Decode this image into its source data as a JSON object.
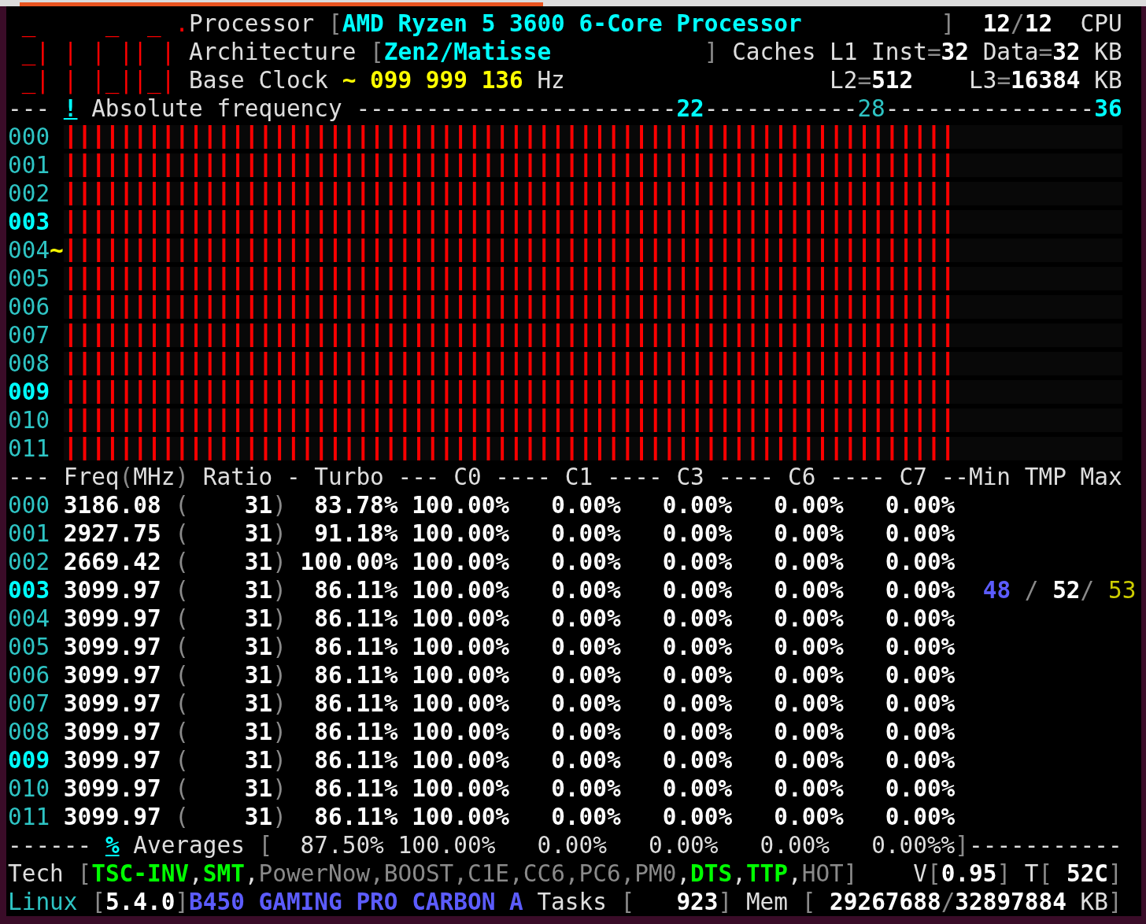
{
  "header": [
    [
      {
        "kind": "red",
        "text": " _     _  _ ."
      },
      {
        "kind": "text",
        "text": "Processor "
      },
      {
        "kind": "dim",
        "text": "["
      },
      {
        "kind": "cyan",
        "text": "AMD Ryzen 5 3600 6-Core Processor"
      },
      {
        "kind": "dim",
        "text": "          ]"
      },
      {
        "kind": "bold",
        "text": "  12"
      },
      {
        "kind": "dim",
        "text": "/"
      },
      {
        "kind": "bold",
        "text": "12"
      },
      {
        "kind": "text",
        "text": "  CPU"
      }
    ],
    [
      {
        "kind": "red",
        "text": " _| | | || |"
      },
      {
        "kind": "text",
        "text": " Architecture "
      },
      {
        "kind": "dim",
        "text": "["
      },
      {
        "kind": "cyan",
        "text": "Zen2/Matisse"
      },
      {
        "kind": "dim",
        "text": "           ]"
      },
      {
        "kind": "text",
        "text": " Caches L1 Inst"
      },
      {
        "kind": "dim",
        "text": "="
      },
      {
        "kind": "bold",
        "text": "32"
      },
      {
        "kind": "text",
        "text": " Data"
      },
      {
        "kind": "dim",
        "text": "="
      },
      {
        "kind": "bold",
        "text": "32"
      },
      {
        "kind": "text",
        "text": " KB"
      }
    ],
    [
      {
        "kind": "red",
        "text": " _| | |_||_|"
      },
      {
        "kind": "text",
        "text": " Base Clock "
      },
      {
        "kind": "yellow",
        "text": "~"
      },
      {
        "kind": "yellow",
        "text": " 099 999 136"
      },
      {
        "kind": "text",
        "text": " Hz"
      },
      {
        "kind": "text",
        "text": "                   L2"
      },
      {
        "kind": "dim",
        "text": "="
      },
      {
        "kind": "bold",
        "text": "512"
      },
      {
        "kind": "text",
        "text": "    L3"
      },
      {
        "kind": "dim",
        "text": "="
      },
      {
        "kind": "bold",
        "text": "16384"
      },
      {
        "kind": "text",
        "text": " KB"
      }
    ],
    [
      {
        "kind": "dash",
        "text": "--- "
      },
      {
        "kind": "link",
        "text": "!"
      },
      {
        "kind": "text",
        "text": " Absolute frequency "
      },
      {
        "kind": "dash",
        "text": "-----------------------"
      },
      {
        "kind": "cyan",
        "text": "22"
      },
      {
        "kind": "dash",
        "text": "-----------"
      },
      {
        "kind": "cyan_dim",
        "text": "28"
      },
      {
        "kind": "dash",
        "text": "---------------"
      },
      {
        "kind": "cyan",
        "text": "36"
      }
    ]
  ],
  "bar_rows": [
    {
      "cpu": "000",
      "current": false,
      "level": 0.8421
    },
    {
      "cpu": "001",
      "current": false,
      "level": 0.8421
    },
    {
      "cpu": "002",
      "current": false,
      "level": 0.8421
    },
    {
      "cpu": "003",
      "current": true,
      "level": 0.8421
    },
    {
      "cpu": "004",
      "current": false,
      "marker": "~",
      "level": 0.8421
    },
    {
      "cpu": "005",
      "current": false,
      "level": 0.8421
    },
    {
      "cpu": "006",
      "current": false,
      "level": 0.8421
    },
    {
      "cpu": "007",
      "current": false,
      "level": 0.8421
    },
    {
      "cpu": "008",
      "current": false,
      "level": 0.8421
    },
    {
      "cpu": "009",
      "current": true,
      "level": 0.8421
    },
    {
      "cpu": "010",
      "current": false,
      "level": 0.8421
    },
    {
      "cpu": "011",
      "current": false,
      "level": 0.8421
    }
  ],
  "table": [
    [
      {
        "kind": "dash",
        "text": "--- "
      },
      {
        "kind": "text",
        "text": "Freq"
      },
      {
        "kind": "dim",
        "text": "("
      },
      {
        "kind": "text",
        "text": "MHz"
      },
      {
        "kind": "dim",
        "text": ")"
      },
      {
        "kind": "text",
        "text": " Ratio - Turbo --- C0 ---- C1 ---- C3 ---- C6 ---- C7 --Min TMP Max"
      }
    ],
    [
      {
        "kind": "id",
        "text": "000"
      },
      {
        "kind": "bold",
        "text": " 3186.08"
      },
      {
        "kind": "dim",
        "text": " ("
      },
      {
        "kind": "bold",
        "text": "    31"
      },
      {
        "kind": "dim",
        "text": ")"
      },
      {
        "kind": "bold",
        "text": "  83.78%"
      },
      {
        "kind": "bold",
        "text": " 100.00%"
      },
      {
        "kind": "bold",
        "text": "   0.00%"
      },
      {
        "kind": "bold",
        "text": "   0.00%"
      },
      {
        "kind": "bold",
        "text": "   0.00%"
      },
      {
        "kind": "bold",
        "text": "   0.00%"
      }
    ],
    [
      {
        "kind": "id",
        "text": "001"
      },
      {
        "kind": "bold",
        "text": " 2927.75"
      },
      {
        "kind": "dim",
        "text": " ("
      },
      {
        "kind": "bold",
        "text": "    31"
      },
      {
        "kind": "dim",
        "text": ")"
      },
      {
        "kind": "bold",
        "text": "  91.18%"
      },
      {
        "kind": "bold",
        "text": " 100.00%"
      },
      {
        "kind": "bold",
        "text": "   0.00%"
      },
      {
        "kind": "bold",
        "text": "   0.00%"
      },
      {
        "kind": "bold",
        "text": "   0.00%"
      },
      {
        "kind": "bold",
        "text": "   0.00%"
      }
    ],
    [
      {
        "kind": "id",
        "text": "002"
      },
      {
        "kind": "bold",
        "text": " 2669.42"
      },
      {
        "kind": "dim",
        "text": " ("
      },
      {
        "kind": "bold",
        "text": "    31"
      },
      {
        "kind": "dim",
        "text": ")"
      },
      {
        "kind": "bold",
        "text": " 100.00%"
      },
      {
        "kind": "bold",
        "text": " 100.00%"
      },
      {
        "kind": "bold",
        "text": "   0.00%"
      },
      {
        "kind": "bold",
        "text": "   0.00%"
      },
      {
        "kind": "bold",
        "text": "   0.00%"
      },
      {
        "kind": "bold",
        "text": "   0.00%"
      }
    ],
    [
      {
        "kind": "id_hi",
        "text": "003"
      },
      {
        "kind": "bold",
        "text": " 3099.97"
      },
      {
        "kind": "dim",
        "text": " ("
      },
      {
        "kind": "bold",
        "text": "    31"
      },
      {
        "kind": "dim",
        "text": ")"
      },
      {
        "kind": "bold",
        "text": "  86.11%"
      },
      {
        "kind": "bold",
        "text": " 100.00%"
      },
      {
        "kind": "bold",
        "text": "   0.00%"
      },
      {
        "kind": "bold",
        "text": "   0.00%"
      },
      {
        "kind": "bold",
        "text": "   0.00%"
      },
      {
        "kind": "bold",
        "text": "   0.00%"
      },
      {
        "kind": "blue",
        "text": "  48"
      },
      {
        "kind": "dim",
        "text": " /"
      },
      {
        "kind": "bold",
        "text": " 52"
      },
      {
        "kind": "dim",
        "text": "/"
      },
      {
        "kind": "yellow_dim",
        "text": " 53"
      }
    ],
    [
      {
        "kind": "id",
        "text": "004"
      },
      {
        "kind": "bold",
        "text": " 3099.97"
      },
      {
        "kind": "dim",
        "text": " ("
      },
      {
        "kind": "bold",
        "text": "    31"
      },
      {
        "kind": "dim",
        "text": ")"
      },
      {
        "kind": "bold",
        "text": "  86.11%"
      },
      {
        "kind": "bold",
        "text": " 100.00%"
      },
      {
        "kind": "bold",
        "text": "   0.00%"
      },
      {
        "kind": "bold",
        "text": "   0.00%"
      },
      {
        "kind": "bold",
        "text": "   0.00%"
      },
      {
        "kind": "bold",
        "text": "   0.00%"
      }
    ],
    [
      {
        "kind": "id",
        "text": "005"
      },
      {
        "kind": "bold",
        "text": " 3099.97"
      },
      {
        "kind": "dim",
        "text": " ("
      },
      {
        "kind": "bold",
        "text": "    31"
      },
      {
        "kind": "dim",
        "text": ")"
      },
      {
        "kind": "bold",
        "text": "  86.11%"
      },
      {
        "kind": "bold",
        "text": " 100.00%"
      },
      {
        "kind": "bold",
        "text": "   0.00%"
      },
      {
        "kind": "bold",
        "text": "   0.00%"
      },
      {
        "kind": "bold",
        "text": "   0.00%"
      },
      {
        "kind": "bold",
        "text": "   0.00%"
      }
    ],
    [
      {
        "kind": "id",
        "text": "006"
      },
      {
        "kind": "bold",
        "text": " 3099.97"
      },
      {
        "kind": "dim",
        "text": " ("
      },
      {
        "kind": "bold",
        "text": "    31"
      },
      {
        "kind": "dim",
        "text": ")"
      },
      {
        "kind": "bold",
        "text": "  86.11%"
      },
      {
        "kind": "bold",
        "text": " 100.00%"
      },
      {
        "kind": "bold",
        "text": "   0.00%"
      },
      {
        "kind": "bold",
        "text": "   0.00%"
      },
      {
        "kind": "bold",
        "text": "   0.00%"
      },
      {
        "kind": "bold",
        "text": "   0.00%"
      }
    ],
    [
      {
        "kind": "id",
        "text": "007"
      },
      {
        "kind": "bold",
        "text": " 3099.97"
      },
      {
        "kind": "dim",
        "text": " ("
      },
      {
        "kind": "bold",
        "text": "    31"
      },
      {
        "kind": "dim",
        "text": ")"
      },
      {
        "kind": "bold",
        "text": "  86.11%"
      },
      {
        "kind": "bold",
        "text": " 100.00%"
      },
      {
        "kind": "bold",
        "text": "   0.00%"
      },
      {
        "kind": "bold",
        "text": "   0.00%"
      },
      {
        "kind": "bold",
        "text": "   0.00%"
      },
      {
        "kind": "bold",
        "text": "   0.00%"
      }
    ],
    [
      {
        "kind": "id",
        "text": "008"
      },
      {
        "kind": "bold",
        "text": " 3099.97"
      },
      {
        "kind": "dim",
        "text": " ("
      },
      {
        "kind": "bold",
        "text": "    31"
      },
      {
        "kind": "dim",
        "text": ")"
      },
      {
        "kind": "bold",
        "text": "  86.11%"
      },
      {
        "kind": "bold",
        "text": " 100.00%"
      },
      {
        "kind": "bold",
        "text": "   0.00%"
      },
      {
        "kind": "bold",
        "text": "   0.00%"
      },
      {
        "kind": "bold",
        "text": "   0.00%"
      },
      {
        "kind": "bold",
        "text": "   0.00%"
      }
    ],
    [
      {
        "kind": "id_hi",
        "text": "009"
      },
      {
        "kind": "bold",
        "text": " 3099.97"
      },
      {
        "kind": "dim",
        "text": " ("
      },
      {
        "kind": "bold",
        "text": "    31"
      },
      {
        "kind": "dim",
        "text": ")"
      },
      {
        "kind": "bold",
        "text": "  86.11%"
      },
      {
        "kind": "bold",
        "text": " 100.00%"
      },
      {
        "kind": "bold",
        "text": "   0.00%"
      },
      {
        "kind": "bold",
        "text": "   0.00%"
      },
      {
        "kind": "bold",
        "text": "   0.00%"
      },
      {
        "kind": "bold",
        "text": "   0.00%"
      }
    ],
    [
      {
        "kind": "id",
        "text": "010"
      },
      {
        "kind": "bold",
        "text": " 3099.97"
      },
      {
        "kind": "dim",
        "text": " ("
      },
      {
        "kind": "bold",
        "text": "    31"
      },
      {
        "kind": "dim",
        "text": ")"
      },
      {
        "kind": "bold",
        "text": "  86.11%"
      },
      {
        "kind": "bold",
        "text": " 100.00%"
      },
      {
        "kind": "bold",
        "text": "   0.00%"
      },
      {
        "kind": "bold",
        "text": "   0.00%"
      },
      {
        "kind": "bold",
        "text": "   0.00%"
      },
      {
        "kind": "bold",
        "text": "   0.00%"
      }
    ],
    [
      {
        "kind": "id",
        "text": "011"
      },
      {
        "kind": "bold",
        "text": " 3099.97"
      },
      {
        "kind": "dim",
        "text": " ("
      },
      {
        "kind": "bold",
        "text": "    31"
      },
      {
        "kind": "dim",
        "text": ")"
      },
      {
        "kind": "bold",
        "text": "  86.11%"
      },
      {
        "kind": "bold",
        "text": " 100.00%"
      },
      {
        "kind": "bold",
        "text": "   0.00%"
      },
      {
        "kind": "bold",
        "text": "   0.00%"
      },
      {
        "kind": "bold",
        "text": "   0.00%"
      },
      {
        "kind": "bold",
        "text": "   0.00%"
      }
    ],
    [
      {
        "kind": "dash",
        "text": "------ "
      },
      {
        "kind": "link",
        "text": "%"
      },
      {
        "kind": "text",
        "text": " Averages "
      },
      {
        "kind": "dim",
        "text": "["
      },
      {
        "kind": "text",
        "text": "  87.50%"
      },
      {
        "kind": "text",
        "text": " 100.00%"
      },
      {
        "kind": "text",
        "text": "   0.00%"
      },
      {
        "kind": "text",
        "text": "   0.00%"
      },
      {
        "kind": "text",
        "text": "   0.00%"
      },
      {
        "kind": "text",
        "text": "   0.00%%"
      },
      {
        "kind": "dim",
        "text": "]"
      },
      {
        "kind": "dash",
        "text": "-----------"
      }
    ],
    [
      {
        "kind": "text",
        "text": "Tech "
      },
      {
        "kind": "dim",
        "text": "["
      },
      {
        "kind": "green",
        "text": "TSC-INV"
      },
      {
        "kind": "text",
        "text": ","
      },
      {
        "kind": "green",
        "text": "SMT"
      },
      {
        "kind": "text",
        "text": ","
      },
      {
        "kind": "grey",
        "text": "PowerNow,BOOST,C1E,CC6,PC6,PM0"
      },
      {
        "kind": "text",
        "text": ","
      },
      {
        "kind": "green",
        "text": "DTS"
      },
      {
        "kind": "text",
        "text": ","
      },
      {
        "kind": "green",
        "text": "TTP"
      },
      {
        "kind": "text",
        "text": ","
      },
      {
        "kind": "grey",
        "text": "HOT"
      },
      {
        "kind": "dim",
        "text": "]"
      },
      {
        "kind": "text",
        "text": "    V"
      },
      {
        "kind": "dim",
        "text": "["
      },
      {
        "kind": "bold",
        "text": "0.95"
      },
      {
        "kind": "dim",
        "text": "]"
      },
      {
        "kind": "text",
        "text": " T"
      },
      {
        "kind": "dim",
        "text": "["
      },
      {
        "kind": "bold",
        "text": " 52C"
      },
      {
        "kind": "dim",
        "text": "]"
      }
    ],
    [
      {
        "kind": "cyan_dim",
        "text": "Linux "
      },
      {
        "kind": "dim",
        "text": "["
      },
      {
        "kind": "bold",
        "text": "5.4.0"
      },
      {
        "kind": "dim",
        "text": "]"
      },
      {
        "kind": "blue",
        "text": "B450 GAMING PRO CARBON A"
      },
      {
        "kind": "text",
        "text": " Tasks "
      },
      {
        "kind": "dim",
        "text": "["
      },
      {
        "kind": "bold",
        "text": "   923"
      },
      {
        "kind": "dim",
        "text": "]"
      },
      {
        "kind": "text",
        "text": " Mem "
      },
      {
        "kind": "dim",
        "text": "["
      },
      {
        "kind": "bold",
        "text": " 29267688"
      },
      {
        "kind": "dim",
        "text": "/"
      },
      {
        "kind": "bold",
        "text": "32897884"
      },
      {
        "kind": "text",
        "text": " KB"
      },
      {
        "kind": "dim",
        "text": "]"
      }
    ]
  ]
}
